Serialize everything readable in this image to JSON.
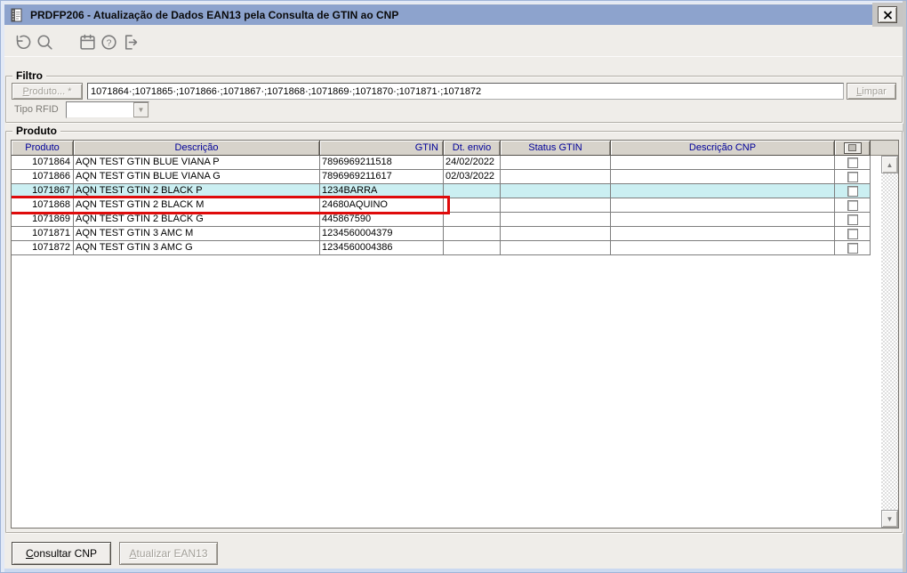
{
  "window": {
    "title": "PRDFP206 - Atualização de Dados EAN13 pela Consulta de GTIN ao CNP",
    "close_glyph": "✕"
  },
  "toolbar": {
    "icons": [
      "undo-icon",
      "search-icon",
      "calendar-icon",
      "help-icon",
      "exit-icon"
    ]
  },
  "filter": {
    "group_label": "Filtro",
    "produto_button": "Produto... *",
    "produto_value": "1071864·;1071865·;1071866·;1071867·;1071868·;1071869·;1071870·;1071871·;1071872",
    "limpar_button": "Limpar",
    "tipo_rfid_label": "Tipo RFID",
    "tipo_rfid_value": "",
    "combo_arrow_glyph": "▼"
  },
  "produto_group": {
    "group_label": "Produto",
    "columns": [
      "Produto",
      "Descrição",
      "GTIN",
      "Dt. envio",
      "Status GTIN",
      "Descrição CNP"
    ],
    "rows": [
      {
        "produto": "1071864",
        "descricao": "AQN TEST GTIN BLUE VIANA P",
        "gtin": "7896969211518",
        "dt_envio": "24/02/2022",
        "status_gtin": "",
        "descricao_cnp": "",
        "state": "",
        "checked": false
      },
      {
        "produto": "1071866",
        "descricao": "AQN TEST GTIN BLUE VIANA G",
        "gtin": "7896969211617",
        "dt_envio": "02/03/2022",
        "status_gtin": "",
        "descricao_cnp": "",
        "state": "",
        "checked": false
      },
      {
        "produto": "1071867",
        "descricao": "AQN TEST GTIN 2 BLACK P",
        "gtin": "1234BARRA",
        "dt_envio": "",
        "status_gtin": "",
        "descricao_cnp": "",
        "state": "selected",
        "checked": false
      },
      {
        "produto": "1071868",
        "descricao": "AQN TEST GTIN 2 BLACK M",
        "gtin": "24680AQUINO",
        "dt_envio": "",
        "status_gtin": "",
        "descricao_cnp": "",
        "state": "flagged",
        "checked": false
      },
      {
        "produto": "1071869",
        "descricao": "AQN TEST GTIN 2 BLACK G",
        "gtin": "445867590",
        "dt_envio": "",
        "status_gtin": "",
        "descricao_cnp": "",
        "state": "",
        "checked": false
      },
      {
        "produto": "1071871",
        "descricao": "AQN TEST GTIN 3 AMC M",
        "gtin": "1234560004379",
        "dt_envio": "",
        "status_gtin": "",
        "descricao_cnp": "",
        "state": "",
        "checked": false
      },
      {
        "produto": "1071872",
        "descricao": "AQN TEST GTIN 3 AMC G",
        "gtin": "1234560004386",
        "dt_envio": "",
        "status_gtin": "",
        "descricao_cnp": "",
        "state": "",
        "checked": false
      }
    ],
    "scrollbar": {
      "up_glyph": "▲",
      "down_glyph": "▼"
    }
  },
  "footer": {
    "consultar_button": "Consultar CNP",
    "atualizar_button": "Atualizar EAN13"
  },
  "colors": {
    "titlebar_bg": "#8DA3CD",
    "grid_header_text": "#000099",
    "selected_row_bg": "#CBEFF2",
    "flag_border": "#DF0B0B"
  }
}
